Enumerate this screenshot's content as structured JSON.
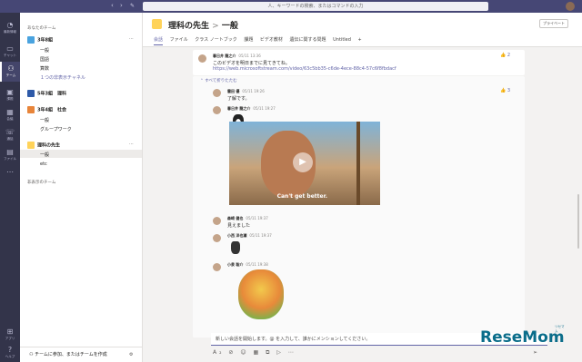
{
  "app": {
    "search_placeholder": "人、キーワードの検索、またはコマンドの入力"
  },
  "rail": [
    {
      "label": "最新情報",
      "icon": "bell-icon"
    },
    {
      "label": "チャット",
      "icon": "chat-icon"
    },
    {
      "label": "チーム",
      "icon": "teams-icon",
      "active": true
    },
    {
      "label": "課題",
      "icon": "assignments-icon"
    },
    {
      "label": "会議",
      "icon": "calendar-icon"
    },
    {
      "label": "通話",
      "icon": "phone-icon"
    },
    {
      "label": "ファイル",
      "icon": "files-icon"
    },
    {
      "label": "アプリ",
      "icon": "apps-icon"
    },
    {
      "label": "ヘルプ",
      "icon": "help-icon"
    }
  ],
  "teams_panel": {
    "heading": "あなたのチーム",
    "hidden_heading": "非表示のチーム",
    "teams": [
      {
        "name": "3年8組",
        "color": "#4aa3df",
        "channels": [
          "一般",
          "国語",
          "算数"
        ],
        "hidden_link": "１つの非表示チャネル"
      },
      {
        "name": "5年3組　理科",
        "color": "#2e5aa8",
        "channels": []
      },
      {
        "name": "3年4組　社会",
        "color": "#e8853a",
        "channels": [
          "一般",
          "グループワーク"
        ]
      },
      {
        "name": "理科の先生",
        "color": "#ffd35a",
        "channels": [
          "一般",
          "etc"
        ]
      }
    ],
    "footer": "チームに参加、またはチームを作成"
  },
  "header": {
    "team": "理科の先生",
    "separator": ">",
    "channel": "一般",
    "private_label": "プライベート",
    "tabs": [
      "会話",
      "ファイル",
      "クラス ノートブック",
      "課題",
      "ビデオ教材",
      "遺伝に関する問題",
      "Untitled",
      "+"
    ]
  },
  "posts": {
    "first": {
      "author": "春日井 龍之介",
      "time": "05/11 13:36",
      "text": "このビデオを明日までに見てきてね。",
      "link": "https://web.microsoftstream.com/video/63c5bb35-c6de-4ece-88c4-57c6f8fbdacf",
      "likes": "2"
    },
    "collapse": "すべて折りたたむ",
    "reply1": {
      "author": "雲田 優",
      "time": "05/11 19:26",
      "text": "了解です。",
      "likes": "3"
    },
    "reply2": {
      "author": "春日井 龍之介",
      "time": "05/11 19:27"
    },
    "video_caption": "Can't get better.",
    "reply3": {
      "author": "森崎 健也",
      "time": "05/11 19:37",
      "text": "見えました"
    },
    "reply4": {
      "author": "小西 洋也瀬",
      "time": "05/11 19:37"
    },
    "reply5": {
      "author": "小泉 聡介",
      "time": "05/11 19:38"
    }
  },
  "composer": {
    "placeholder": "新しい会話を開始します。@ を入力して、誰かにメンションしてください。",
    "tools": "A₂ ⊘ ☺ ▦ ⧉ ▷ ⋯",
    "send": "➢"
  },
  "watermark": {
    "main": "ReseMom",
    "sub": "リセマム"
  }
}
